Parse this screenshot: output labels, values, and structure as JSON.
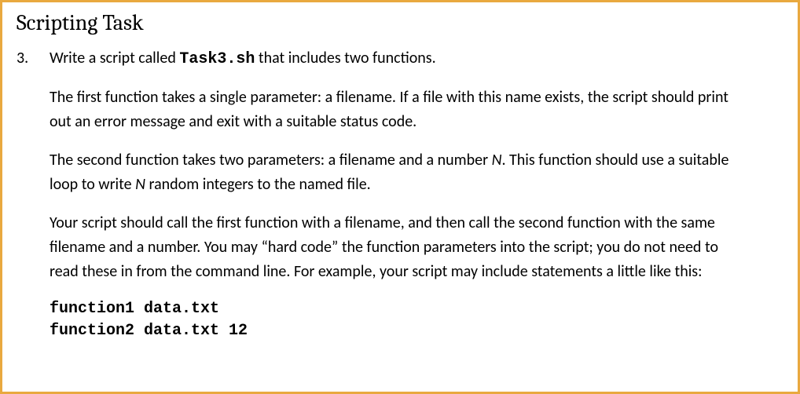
{
  "title": "Scripting Task",
  "item_number": "3.",
  "intro": {
    "pre": "Write a script called ",
    "code": "Task3.sh",
    "post": " that includes two functions."
  },
  "para1": "The first function takes a single parameter: a filename.  If a file with this name exists, the script should print out an error message and exit with a suitable status code.",
  "para2": {
    "a": "The second function takes two parameters: a filename and a number ",
    "n1": "N",
    "b": ".  This function should use a suitable loop to write ",
    "n2": "N",
    "c": " random integers to the named file."
  },
  "para3": "Your script should call the first function with a filename, and then call the second function with the same filename and a number.  You may “hard code” the function parameters into the script; you do not need to read these in from the command line.  For example, your script may include statements a little like this:",
  "code_line1": "function1 data.txt",
  "code_line2": "function2 data.txt 12"
}
